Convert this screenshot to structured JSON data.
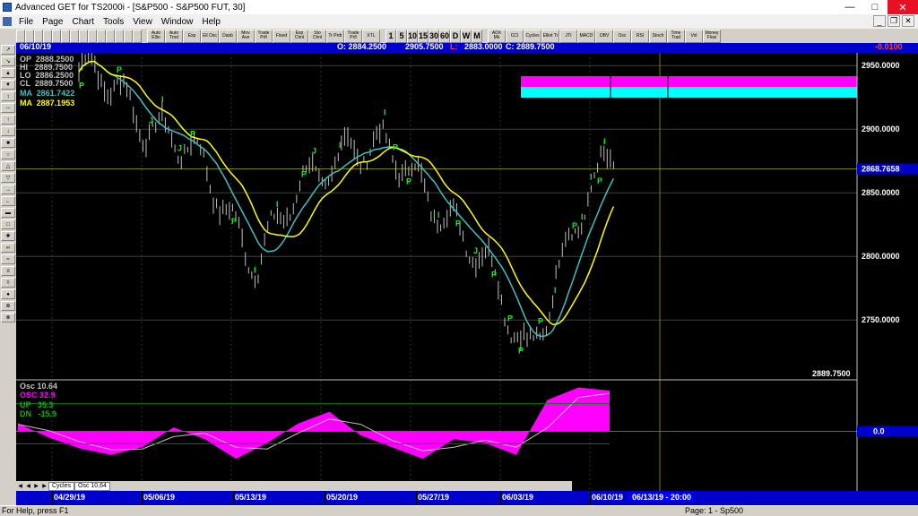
{
  "window": {
    "title": "Advanced GET for TS2000i - [S&P500 - S&P500 FUT, 30]"
  },
  "menu": [
    "File",
    "Page",
    "Chart",
    "Tools",
    "View",
    "Window",
    "Help"
  ],
  "toolbar": {
    "study_buttons": [
      "Auto Ellio",
      "Auto Trnd",
      "Exp",
      "Ell Osc",
      "Dasb",
      "Mov Ave",
      "Trade Prfl",
      "Fixed",
      "Exp Chnl",
      "Sto Chnl",
      "Tr Prdr",
      "Trade Prfl",
      "XTL"
    ],
    "interval_buttons": [
      "1",
      "5",
      "10",
      "15",
      "30",
      "60",
      "D",
      "W",
      "M"
    ],
    "indicator_buttons": [
      "ADX Mk",
      "CCI",
      "Cycles",
      "Elliot Tr",
      "JTI",
      "MACD",
      "OBV",
      "Osc",
      "RSI",
      "Stoch",
      "Time Trad",
      "Vol",
      "Money Flow"
    ]
  },
  "infobar": {
    "date": "06/10/19",
    "open": "O: 2884.2500",
    "high": "2905.7500",
    "low_label": "L:",
    "low": "2883.0000",
    "close": "C: 2889.7500",
    "change": "-0.0100"
  },
  "legend": {
    "op": "OP  2888.2500",
    "hi": "HI   2889.7500",
    "lo": "LO  2886.2500",
    "cl": "CL  2889.7500",
    "ma1": "MA  2861.7422",
    "ma2": "MA  2887.1953"
  },
  "osc_legend": {
    "osc1": "Osc 10.64",
    "osc2": "OSC 32.9",
    "up": "UP   35.3",
    "dn": "DN   -15.9"
  },
  "price_axis": {
    "labels": [
      "2950.0000",
      "2900.0000",
      "2850.0000",
      "2800.0000",
      "2750.0000"
    ],
    "current_label": "2868.7658",
    "last_price": "2889.7500"
  },
  "osc_axis": {
    "zero_label": "0.0"
  },
  "tabs": [
    "Cycles",
    "Osc 10,64"
  ],
  "dates": [
    "04/29/19",
    "05/06/19",
    "05/13/19",
    "05/20/19",
    "05/27/19",
    "06/03/19",
    "06/10/19"
  ],
  "future_date": "06/13/19 - 20:00",
  "status": {
    "left": "For Help, press F1",
    "right": "Page: 1 - Sp500"
  },
  "colors": {
    "price_bars": "#c0c0c0",
    "ma_fast": "#40c0c0",
    "ma_slow": "#ffff00",
    "osc_fill": "#ff00ff",
    "bands": "#008000",
    "pivot_labels": "#00ff00",
    "target_box_magenta": "#ff00ff",
    "target_box_cyan": "#00ffff",
    "background": "#000000"
  },
  "chart_data": {
    "type": "line",
    "title": "",
    "xlabel": "",
    "ylabel": "",
    "ylim": [
      2710,
      2960
    ],
    "x": [
      "04/29/19",
      "05/06/19",
      "05/13/19",
      "05/20/19",
      "05/27/19",
      "06/03/19",
      "06/10/19"
    ],
    "series": [
      {
        "values": [
          2945,
          2900,
          2802,
          2895,
          2850,
          2730,
          2890
        ]
      }
    ],
    "pivot_marks": [
      "P",
      "P",
      "J",
      "I",
      "J",
      "P",
      "P",
      "I",
      "I",
      "P",
      "J",
      "I",
      "I",
      "P",
      "P",
      "I",
      "P",
      "J",
      "P",
      "P",
      "P",
      "P",
      "I",
      "P",
      "I",
      "I",
      "P",
      "I"
    ],
    "oscillator": {
      "ylim": [
        -60,
        60
      ],
      "osc": [
        10,
        -8,
        -22,
        -30,
        -20,
        5,
        -10,
        -35,
        -15,
        10,
        25,
        -5,
        -20,
        -35,
        -10,
        -15,
        -30,
        40,
        56,
        52
      ],
      "up_band": 35.3,
      "dn_band": -15.9
    }
  }
}
